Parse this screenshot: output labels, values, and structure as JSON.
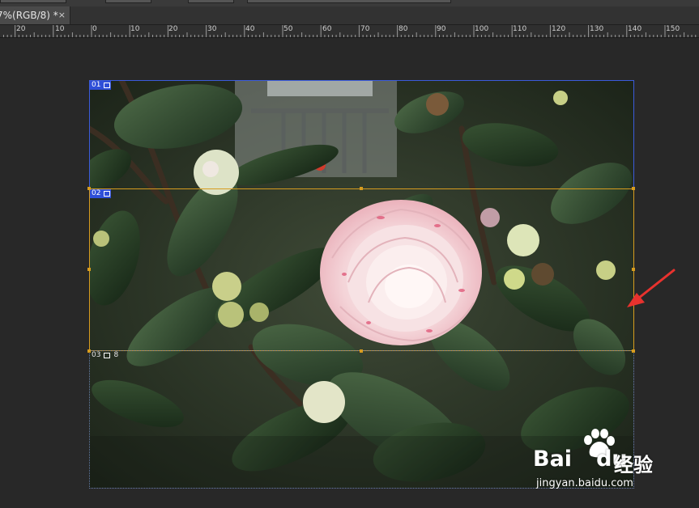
{
  "tab": {
    "title": "7%(RGB/8) *",
    "close": "×"
  },
  "ruler": {
    "labels": [
      "20",
      "10",
      "0",
      "10",
      "20",
      "30",
      "40",
      "50",
      "60",
      "70",
      "80",
      "90",
      "100",
      "110",
      "120",
      "130",
      "140",
      "150"
    ]
  },
  "slices": [
    {
      "number": "01",
      "type": "image"
    },
    {
      "number": "02",
      "type": "image"
    },
    {
      "number": "03",
      "type": "image",
      "extra": "8"
    }
  ],
  "watermark": {
    "brand": "Bai",
    "brand_tail": "du",
    "cn": "经验",
    "url": "jingyan.baidu.com"
  },
  "colors": {
    "slice_selected": "#d79c1f",
    "slice_badge": "#2f4fd8",
    "arrow": "#e8322e"
  }
}
